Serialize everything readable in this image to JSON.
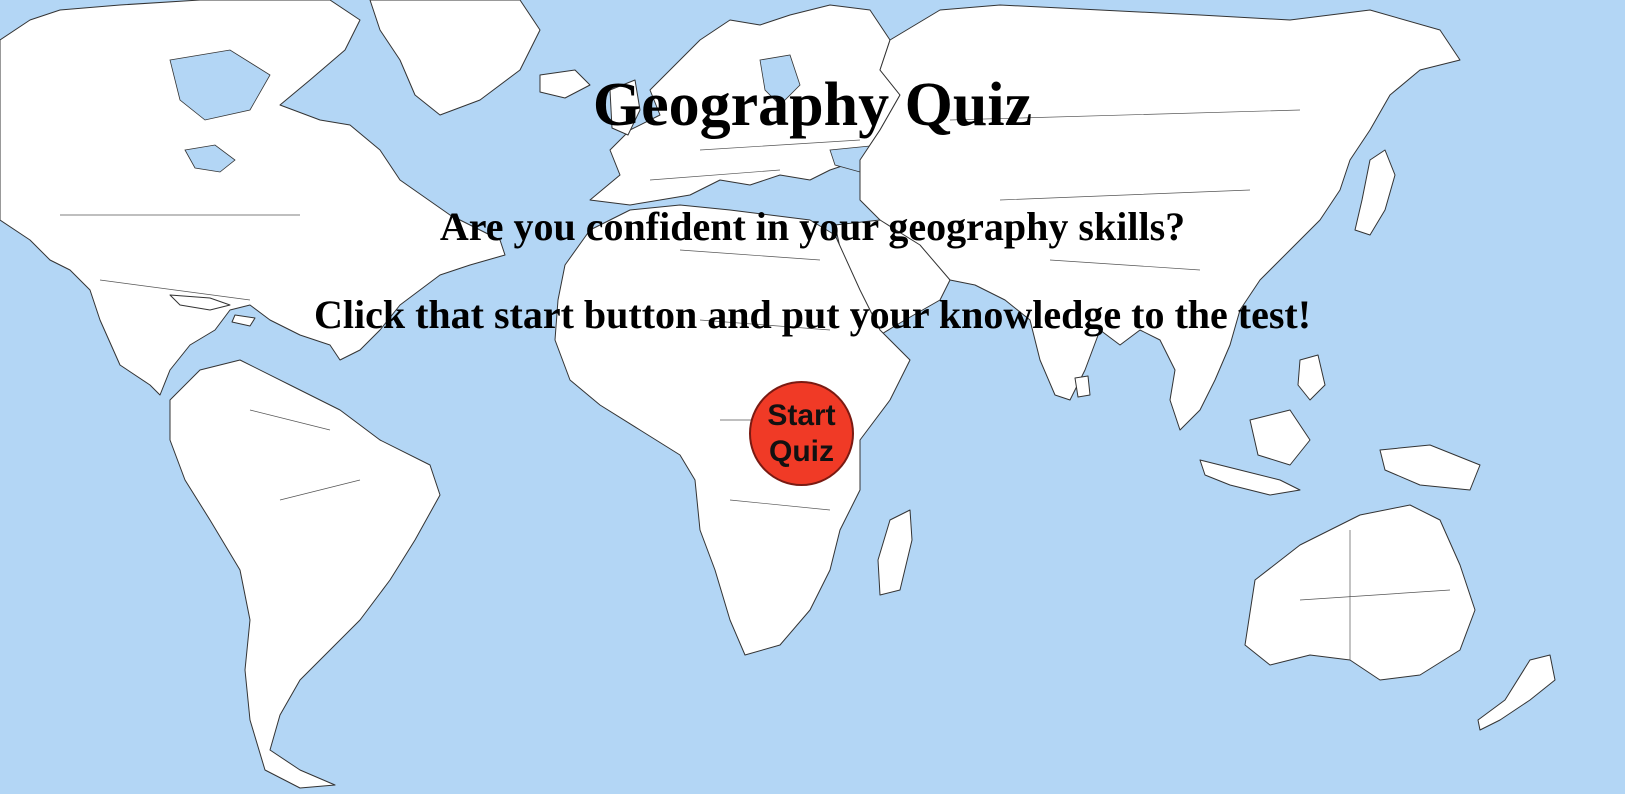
{
  "page": {
    "title": "Geography Quiz",
    "line1": "Are you confident in your geography skills?",
    "line2": "Click that start button and put your knowledge to the test!"
  },
  "start_button": {
    "label": "Start Quiz",
    "color": "#f03a26"
  },
  "colors": {
    "ocean": "#b3d6f5",
    "land": "#ffffff"
  },
  "background_image": "world-map"
}
